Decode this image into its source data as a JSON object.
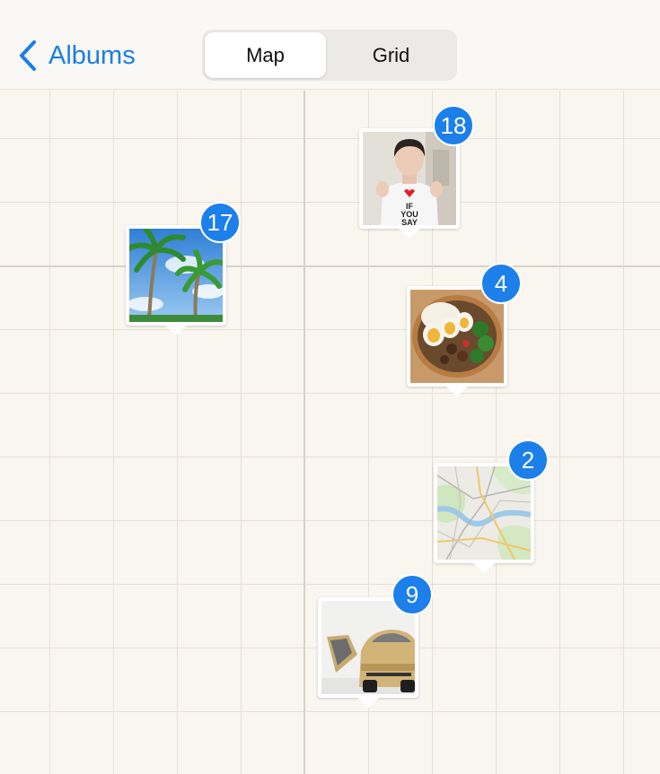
{
  "nav": {
    "back_label": "Albums",
    "back_icon": "chevron-left-icon",
    "accent_color": "#1a7ee6"
  },
  "view_toggle": {
    "options": [
      "Map",
      "Grid"
    ],
    "selected": "Map"
  },
  "pins": [
    {
      "count": "18",
      "photo": "person-photo"
    },
    {
      "count": "17",
      "photo": "palm-trees-photo"
    },
    {
      "count": "4",
      "photo": "food-bento-photo"
    },
    {
      "count": "2",
      "photo": "map-thumbnail-photo"
    },
    {
      "count": "9",
      "photo": "car-photo"
    }
  ],
  "badge_color": "#1c7fea"
}
